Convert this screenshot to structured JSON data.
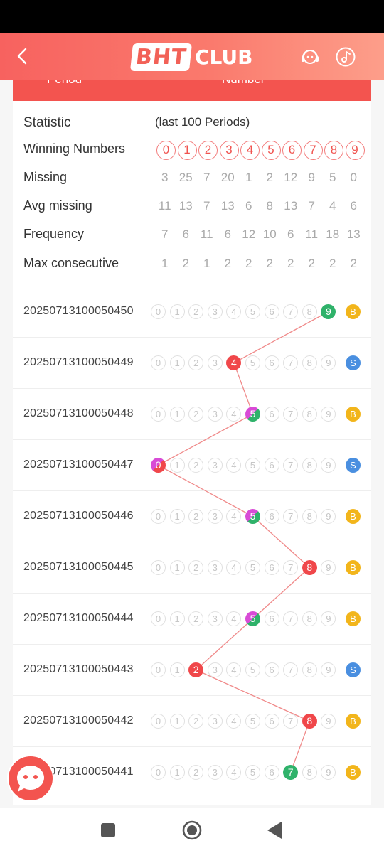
{
  "header": {
    "logo_box": "BHT",
    "logo_text": "CLUB",
    "back_icon": "chevron-left-icon",
    "support_icon": "headset-icon",
    "music_icon": "music-note-icon"
  },
  "table_head": {
    "col1": "Period",
    "col2": "Number"
  },
  "stats": {
    "title": "Statistic",
    "subtitle": "(last 100 Periods)",
    "winning_label": "Winning Numbers",
    "winning_numbers": [
      "0",
      "1",
      "2",
      "3",
      "4",
      "5",
      "6",
      "7",
      "8",
      "9"
    ],
    "rows": [
      {
        "label": "Missing",
        "values": [
          "3",
          "25",
          "7",
          "20",
          "1",
          "2",
          "12",
          "9",
          "5",
          "0"
        ]
      },
      {
        "label": "Avg missing",
        "values": [
          "11",
          "13",
          "7",
          "13",
          "6",
          "8",
          "13",
          "7",
          "4",
          "6"
        ]
      },
      {
        "label": "Frequency",
        "values": [
          "7",
          "6",
          "11",
          "6",
          "12",
          "10",
          "6",
          "11",
          "18",
          "13"
        ]
      },
      {
        "label": "Max consecutive",
        "values": [
          "1",
          "2",
          "1",
          "2",
          "2",
          "2",
          "2",
          "2",
          "2",
          "2"
        ]
      }
    ]
  },
  "periods": [
    {
      "id": "20250713100050450",
      "number": 9,
      "size": "B"
    },
    {
      "id": "20250713100050449",
      "number": 4,
      "size": "S"
    },
    {
      "id": "20250713100050448",
      "number": 5,
      "size": "B"
    },
    {
      "id": "20250713100050447",
      "number": 0,
      "size": "S"
    },
    {
      "id": "20250713100050446",
      "number": 5,
      "size": "B"
    },
    {
      "id": "20250713100050445",
      "number": 8,
      "size": "B"
    },
    {
      "id": "20250713100050444",
      "number": 5,
      "size": "B"
    },
    {
      "id": "20250713100050443",
      "number": 2,
      "size": "S"
    },
    {
      "id": "20250713100050442",
      "number": 8,
      "size": "B"
    },
    {
      "id": "20250713100050441",
      "number": 7,
      "size": "B"
    }
  ],
  "colors": {
    "red": "#f0474a",
    "green": "#2fb26a",
    "violet": "#d84bd6",
    "big": "#f2b51b",
    "small": "#4a8fe0",
    "line": "#f08a8a"
  },
  "ui": {
    "chat_icon": "chat-bubble-icon",
    "nav": [
      "stop-square-icon",
      "home-circle-icon",
      "back-triangle-icon"
    ]
  }
}
